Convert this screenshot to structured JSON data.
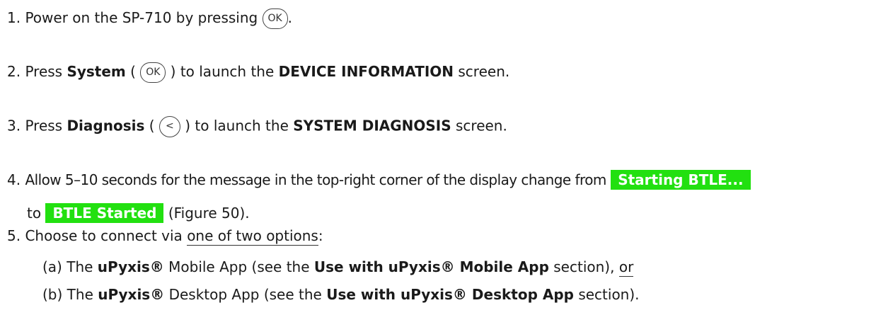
{
  "steps": [
    {
      "num": "1.",
      "a": "Power on the SP-710 by pressing",
      "btn": "OK",
      "b": "."
    },
    {
      "num": "2.",
      "a": "Press",
      "bold1": "System",
      "p1": "(",
      "btn": "OK",
      "p2": ") to launch the",
      "bold2": "DEVICE INFORMATION",
      "c": "screen."
    },
    {
      "num": "3.",
      "a": "Press",
      "bold1": "Diagnosis",
      "p1": "(",
      "btn": "<",
      "p2": ") to launch the",
      "bold2": "SYSTEM DIAGNOSIS",
      "c": "screen."
    },
    {
      "num": "4.",
      "a": "Allow 5–10 seconds for the message in the top-right corner of the display change from",
      "tag1": "Starting BTLE...",
      "to": "to",
      "tag2": "BTLE Started",
      "c": "(Figure 50)."
    },
    {
      "num": "5.",
      "a": "Choose to connect via",
      "u": "one of two options",
      "c": ":"
    }
  ],
  "suboptions": [
    {
      "label": "(a)",
      "a": "The",
      "bold1": "uPyxis®",
      "b": "Mobile App (see the",
      "bold2": "Use with uPyxis® Mobile App",
      "c": "section),",
      "u": "or"
    },
    {
      "label": "(b)",
      "a": "The",
      "bold1": "uPyxis®",
      "b": "Desktop App (see the",
      "bold2": "Use with uPyxis® Desktop App",
      "c": "section)."
    }
  ],
  "colors": {
    "tag_bg": "#22e010",
    "tag_text": "#ffffff"
  },
  "icons": {
    "ok_button": "ok-button-icon",
    "left_button": "left-arrow-button-icon"
  }
}
